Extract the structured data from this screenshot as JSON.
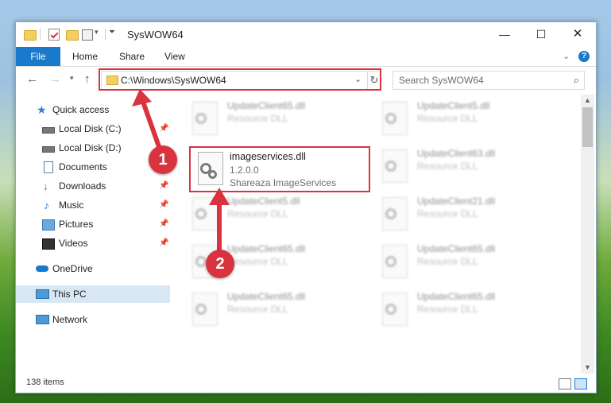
{
  "window": {
    "title": "SysWOW64",
    "minimize_glyph": "—",
    "maximize_glyph": "☐",
    "close_glyph": "✕"
  },
  "ribbon": {
    "tabs": [
      "File",
      "Home",
      "Share",
      "View"
    ],
    "help_glyph": "?",
    "collapse_glyph": "⌄"
  },
  "address": {
    "path": "C:\\Windows\\SysWOW64",
    "search_placeholder": "Search SysWOW64"
  },
  "nav_pane": {
    "items": [
      {
        "label": "Quick access",
        "icon": "star-icon",
        "pinned": false
      },
      {
        "label": "Local Disk (C:)",
        "icon": "drive-icon",
        "pinned": true
      },
      {
        "label": "Local Disk (D:)",
        "icon": "drive-icon",
        "pinned": false
      },
      {
        "label": "Documents",
        "icon": "documents-icon",
        "pinned": true
      },
      {
        "label": "Downloads",
        "icon": "download-icon",
        "pinned": true
      },
      {
        "label": "Music",
        "icon": "music-icon",
        "pinned": true
      },
      {
        "label": "Pictures",
        "icon": "pictures-icon",
        "pinned": true
      },
      {
        "label": "Videos",
        "icon": "videos-icon",
        "pinned": true
      },
      {
        "label": "OneDrive",
        "icon": "cloud-icon",
        "pinned": false
      },
      {
        "label": "This PC",
        "icon": "pc-icon",
        "pinned": false,
        "selected": true
      },
      {
        "label": "Network",
        "icon": "network-icon",
        "pinned": false
      }
    ]
  },
  "files": [
    {
      "name": "UpdateClient65.dll",
      "type": "Resource DLL"
    },
    {
      "name": "UpdateClient5.dll",
      "type": "Resource DLL"
    },
    {
      "name": "UpdateClient63.dll",
      "type": "Resource DLL"
    },
    {
      "name": "UpdateClient5.dll",
      "type": "Resource DLL"
    },
    {
      "name": "UpdateClient21.dll",
      "type": "Resource DLL"
    },
    {
      "name": "UpdateClient65.dll",
      "type": "Resource DLL"
    },
    {
      "name": "UpdateClient65.dll",
      "type": "Resource DLL"
    },
    {
      "name": "UpdateClient65.dll",
      "type": "Resource DLL"
    },
    {
      "name": "UpdateClient65.dll",
      "type": "Resource DLL"
    }
  ],
  "highlighted_file": {
    "name": "imageservices.dll",
    "version": "1.2.0.0",
    "description": "Shareaza ImageServices"
  },
  "status": {
    "item_count": "138 items"
  },
  "markers": [
    "1",
    "2"
  ],
  "colors": {
    "accent": "#1979ca",
    "highlight_red": "#d9333f"
  }
}
